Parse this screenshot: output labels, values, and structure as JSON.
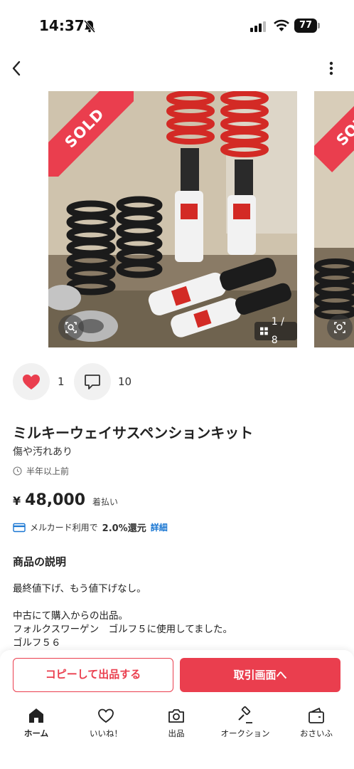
{
  "status_bar": {
    "time": "14:37",
    "battery": "77"
  },
  "carousel": {
    "sold_label": "SOLD",
    "counter": "1 / 8"
  },
  "actions": {
    "like_count": "1",
    "comment_count": "10"
  },
  "item": {
    "title": "ミルキーウェイサスペンションキット",
    "condition": "傷や汚れあり",
    "posted": "半年以上前",
    "price_symbol": "¥",
    "price": "48,000",
    "shipping": "着払い",
    "mercard_text": "メルカード利用で",
    "mercard_rate": "2.0%還元",
    "mercard_link": "詳細"
  },
  "description": {
    "heading": "商品の説明",
    "lines": [
      "最終値下げ、もう値下げなし。",
      "",
      "中古にて購入からの出品。",
      "フォルクスワーゲン　ゴルフ５に使用してました。",
      "ゴルフ５６"
    ]
  },
  "buttons": {
    "copy": "コピーして出品する",
    "trade": "取引画面へ"
  },
  "tabs": [
    {
      "label": "ホーム",
      "icon": "home-icon"
    },
    {
      "label": "いいね！",
      "icon": "heart-icon"
    },
    {
      "label": "出品",
      "icon": "camera-icon"
    },
    {
      "label": "オークション",
      "icon": "gavel-icon"
    },
    {
      "label": "おさいふ",
      "icon": "wallet-icon"
    }
  ],
  "colors": {
    "accent": "#ea3e4e",
    "link": "#1976d2"
  }
}
